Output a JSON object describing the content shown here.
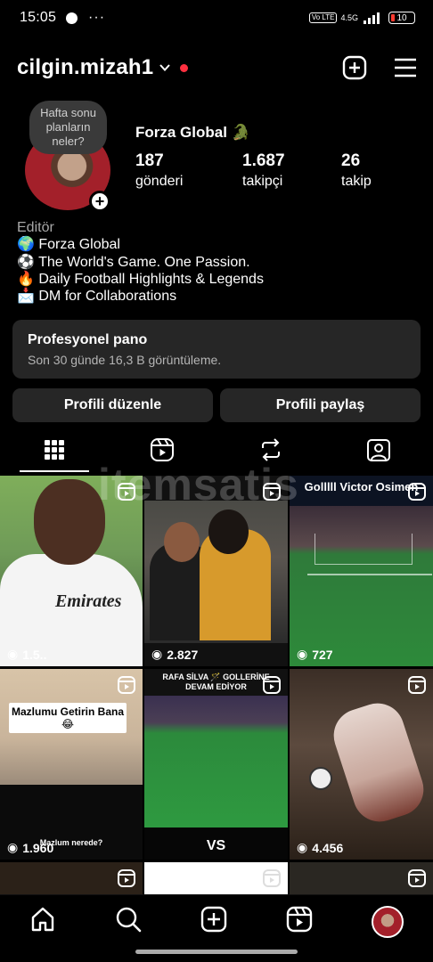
{
  "status_bar": {
    "time": "15:05",
    "more": "···",
    "volte": "Vo LTE",
    "network": "4.5G",
    "battery": "10"
  },
  "header": {
    "username": "cilgin.mizah1"
  },
  "profile": {
    "note_bubble": "Hafta sonu planların neler?",
    "display_name": "Forza Global 🐊",
    "stats": [
      {
        "number": "187",
        "label": "gönderi"
      },
      {
        "number": "1.687",
        "label": "takipçi"
      },
      {
        "number": "26",
        "label": "takip"
      }
    ],
    "category": "Editör",
    "bio": [
      "🌍 Forza Global",
      "⚽ The World's Game. One Passion.",
      "🔥 Daily Football Highlights & Legends",
      "📩 DM for Collaborations"
    ]
  },
  "dashboard": {
    "title": "Profesyonel pano",
    "subtitle": "Son 30 günde 16,3 B görüntüleme."
  },
  "buttons": {
    "edit": "Profili düzenle",
    "share": "Profili paylaş"
  },
  "tabs": [
    "grid-icon",
    "reels-icon",
    "reposts-icon",
    "tagged-icon"
  ],
  "watermark": "itemsatis",
  "grid": [
    {
      "views": "1.5..",
      "caption": ""
    },
    {
      "views": "2.827",
      "caption": ""
    },
    {
      "views": "727",
      "caption": "Golllll Victor Osimen"
    },
    {
      "views": "1.960",
      "caption": "Mazlumu Getirin Bana 😂",
      "caption2": "Mazlum nerede?"
    },
    {
      "views": "",
      "caption": "RAFA SİLVA 🪄 GOLLERİNE DEVAM EDİYOR",
      "caption2": "VS"
    },
    {
      "views": "4.456",
      "caption": ""
    },
    {
      "views": "",
      "caption": ""
    },
    {
      "views": "",
      "caption": ""
    },
    {
      "views": "",
      "caption": ""
    }
  ],
  "colors": {
    "background": "#000000",
    "card": "#262626",
    "notification_dot": "#ff3040"
  }
}
